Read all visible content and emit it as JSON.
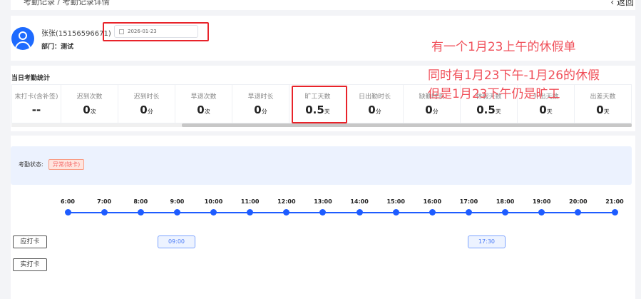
{
  "breadcrumb": {
    "text": "考勤记录 / 考勤记录详情",
    "back": "‹ 返回"
  },
  "user": {
    "name": "张张(15156596671)",
    "dept": "部门：测试",
    "date": "2026-01-23"
  },
  "stats_title": "当日考勤统计",
  "stats": [
    {
      "label": "末打卡(含补签)",
      "value": "--",
      "unit": ""
    },
    {
      "label": "迟到次数",
      "value": "0",
      "unit": "次"
    },
    {
      "label": "迟到时长",
      "value": "0",
      "unit": "分"
    },
    {
      "label": "早退次数",
      "value": "0",
      "unit": "次"
    },
    {
      "label": "早退时长",
      "value": "0",
      "unit": "分"
    },
    {
      "label": "旷工天数",
      "value": "0.5",
      "unit": "天"
    },
    {
      "label": "日出勤时长",
      "value": "0",
      "unit": "分"
    },
    {
      "label": "缺勤时长",
      "value": "0",
      "unit": "分"
    },
    {
      "label": "休假天数",
      "value": "0.5",
      "unit": "天"
    },
    {
      "label": "外出天数",
      "value": "0",
      "unit": "天"
    },
    {
      "label": "出差天数",
      "value": "0",
      "unit": "天"
    }
  ],
  "annotations": [
    "有一个1月23上午的休假单",
    "同时有1月23下午-1月26的休假",
    "但是1月23下午仍是旷工"
  ],
  "status": {
    "label": "考勤状态:",
    "badge": "异常(缺卡)"
  },
  "timeline": [
    "6:00",
    "7:00",
    "8:00",
    "9:00",
    "10:00",
    "11:00",
    "12:00",
    "13:00",
    "14:00",
    "15:00",
    "16:00",
    "17:00",
    "18:00",
    "19:00",
    "20:00",
    "21:00"
  ],
  "rows": {
    "expected": "应打卡",
    "actual": "实打卡"
  },
  "punches": [
    {
      "time": "09:00"
    },
    {
      "time": "17:30"
    }
  ],
  "colors": {
    "accent": "#1e5cff",
    "annotation": "#f0505a",
    "highlight": "#e8232a"
  }
}
